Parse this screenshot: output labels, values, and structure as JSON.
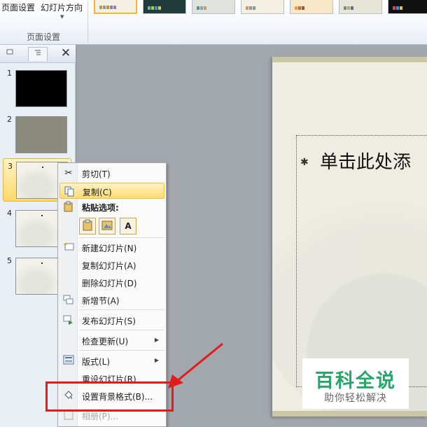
{
  "ribbon": {
    "page_setup_label": "页面设置",
    "orientation_label": "幻灯片方向",
    "group_label": "页面设置",
    "themes": [
      {
        "name": "theme-1",
        "bg": "#f4f0e2",
        "selected": true
      },
      {
        "name": "theme-2",
        "bg": "#1f3b3a",
        "selected": false
      },
      {
        "name": "theme-3",
        "bg": "#dfe3de",
        "selected": false
      },
      {
        "name": "theme-4",
        "bg": "#f4efe3",
        "selected": false
      },
      {
        "name": "theme-5",
        "bg": "#f7e6c8",
        "selected": false
      },
      {
        "name": "theme-6",
        "bg": "#e6e6d8",
        "selected": false
      },
      {
        "name": "theme-7",
        "bg": "#111111",
        "selected": false
      }
    ]
  },
  "left_panel": {
    "tabs": [
      "slides-tab",
      "outline-tab"
    ],
    "close_glyph": "✕",
    "slides": [
      {
        "number": "1",
        "style": "black",
        "selected": false
      },
      {
        "number": "2",
        "style": "olive",
        "selected": false
      },
      {
        "number": "3",
        "style": "fan",
        "selected": true
      },
      {
        "number": "4",
        "style": "fan",
        "selected": false
      },
      {
        "number": "5",
        "style": "fan",
        "selected": false
      }
    ]
  },
  "slide": {
    "bullet": "✱",
    "title_placeholder": "单击此处添"
  },
  "context_menu": {
    "items": {
      "cut": "剪切(T)",
      "copy": "复制(C)",
      "paste_options": "粘贴选项:",
      "new_slide": "新建幻灯片(N)",
      "duplicate_slide": "复制幻灯片(A)",
      "delete_slide": "删除幻灯片(D)",
      "new_section": "新增节(A)",
      "publish_slides": "发布幻灯片(S)",
      "check_updates": "检查更新(U)",
      "layout": "版式(L)",
      "reset_slide": "重设幻灯片(R)",
      "format_background": "设置背景格式(B)...",
      "photo_album": "相册(P)..."
    },
    "paste_glyph_text": "A",
    "highlighted": "copy"
  },
  "annotation": {
    "color": "#e01c1c"
  },
  "watermark": {
    "title": "百科全说",
    "subtitle": "助你轻松解决",
    "color": "#27a56a"
  }
}
